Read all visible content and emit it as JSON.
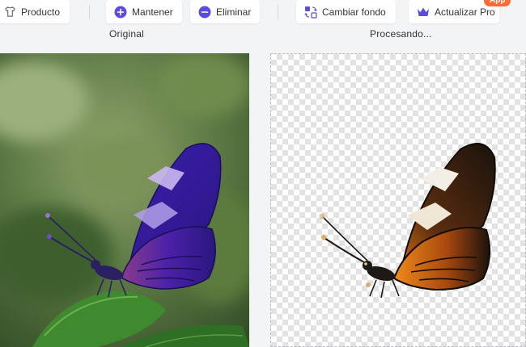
{
  "toolbar": {
    "product_label": "Producto",
    "keep_label": "Mantener",
    "remove_label": "Eliminar",
    "change_bg_label": "Cambiar fondo",
    "upgrade_label": "Actualizar Pro",
    "app_badge": "App"
  },
  "panes": {
    "original_label": "Original",
    "processed_label": "Procesando..."
  },
  "icons": {
    "product": "shirt-icon",
    "keep": "plus-circle-icon",
    "remove": "minus-circle-icon",
    "change_bg": "background-swap-icon",
    "upgrade": "crown-icon"
  },
  "colors": {
    "accent": "#5b4be0",
    "badge": "#ff6b35"
  }
}
